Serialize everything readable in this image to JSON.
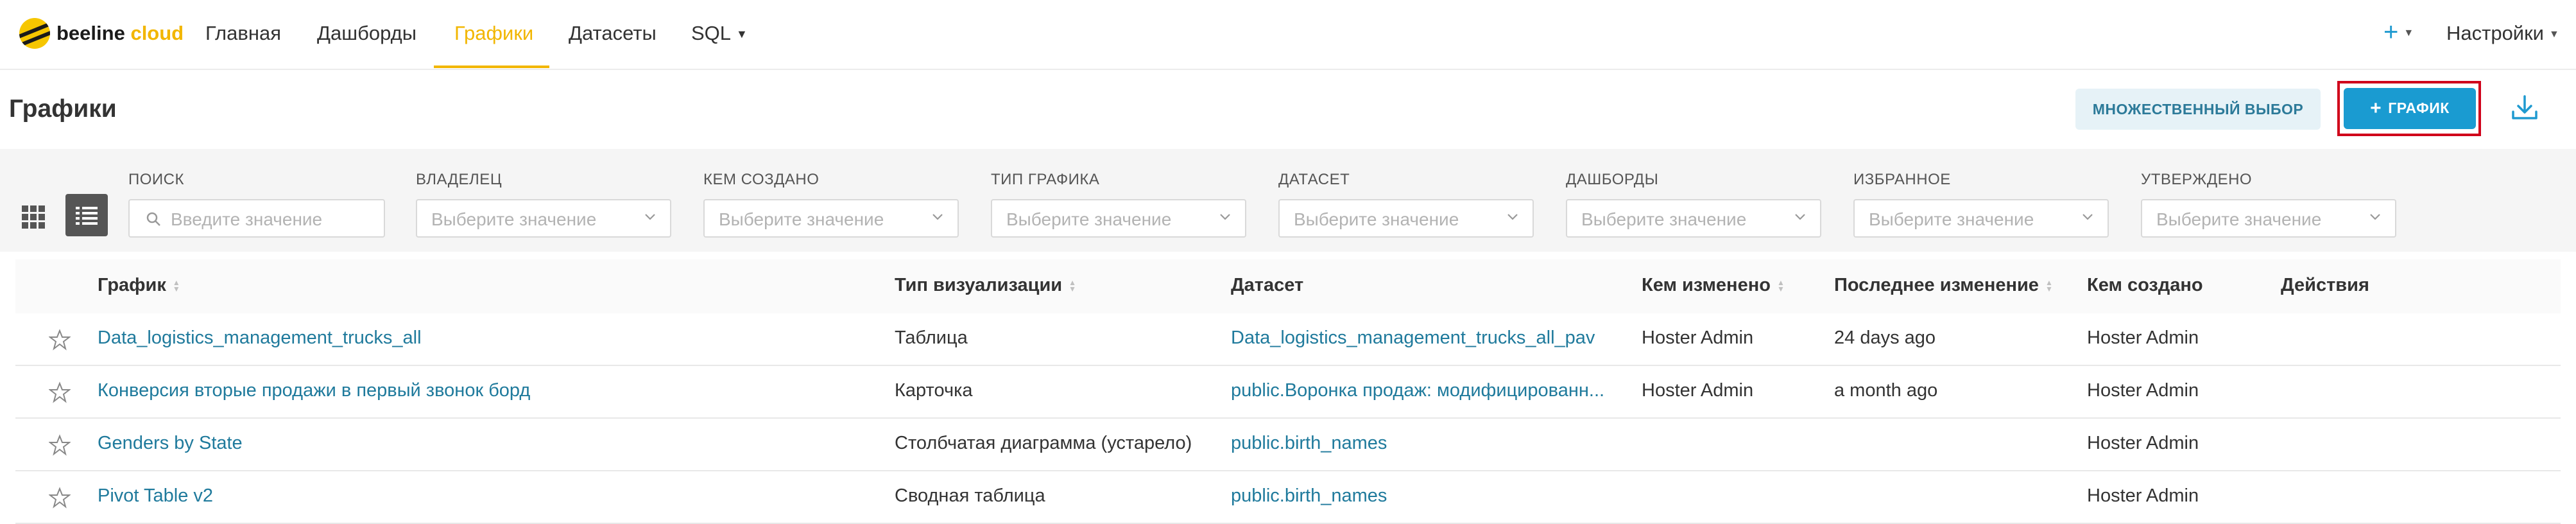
{
  "brand": {
    "name_a": "beeline",
    "name_b": "cloud",
    "accent": "#f2b600"
  },
  "nav": {
    "items": [
      {
        "label": "Главная"
      },
      {
        "label": "Дашборды"
      },
      {
        "label": "Графики",
        "active": true
      },
      {
        "label": "Датасеты"
      },
      {
        "label": "SQL"
      }
    ],
    "plus_label": "+",
    "settings_label": "Настройки"
  },
  "page": {
    "title": "Графики",
    "multi_select_label": "МНОЖЕСТВЕННЫЙ ВЫБОР",
    "add_label": "ГРАФИК",
    "add_plus": "+",
    "primary_color": "#1a9bd1"
  },
  "filters": {
    "search": {
      "label": "ПОИСК",
      "placeholder": "Введите значение"
    },
    "owner": {
      "label": "ВЛАДЕЛЕЦ",
      "placeholder": "Выберите значение"
    },
    "created_by": {
      "label": "КЕМ СОЗДАНО",
      "placeholder": "Выберите значение"
    },
    "chart_type": {
      "label": "ТИП ГРАФИКА",
      "placeholder": "Выберите значение"
    },
    "dataset": {
      "label": "ДАТАСЕТ",
      "placeholder": "Выберите значение"
    },
    "dashboards": {
      "label": "ДАШБОРДЫ",
      "placeholder": "Выберите значение"
    },
    "favorites": {
      "label": "ИЗБРАННОЕ",
      "placeholder": "Выберите значение"
    },
    "certified": {
      "label": "УТВЕРЖДЕНО",
      "placeholder": "Выберите значение"
    }
  },
  "table": {
    "headers": {
      "chart": "График",
      "viz_type": "Тип визуализации",
      "dataset": "Датасет",
      "modified_by": "Кем изменено",
      "last_modified": "Последнее изменение",
      "created_by": "Кем создано",
      "actions": "Действия"
    },
    "rows": [
      {
        "chart": "Data_logistics_management_trucks_all",
        "viz_type": "Таблица",
        "dataset": "Data_logistics_management_trucks_all_pav",
        "modified_by": "Hoster Admin",
        "last_modified": "24 days ago",
        "created_by": "Hoster Admin"
      },
      {
        "chart": "Конверсия вторые продажи в первый звонок борд",
        "viz_type": "Карточка",
        "dataset": "public.Воронка продаж: модифицированн...",
        "modified_by": "Hoster Admin",
        "last_modified": "a month ago",
        "created_by": "Hoster Admin"
      },
      {
        "chart": "Genders by State",
        "viz_type": "Столбчатая диаграмма (устарело)",
        "dataset": "public.birth_names",
        "modified_by": "",
        "last_modified": "",
        "created_by": "Hoster Admin"
      },
      {
        "chart": "Pivot Table v2",
        "viz_type": "Сводная таблица",
        "dataset": "public.birth_names",
        "modified_by": "",
        "last_modified": "",
        "created_by": "Hoster Admin"
      }
    ]
  }
}
